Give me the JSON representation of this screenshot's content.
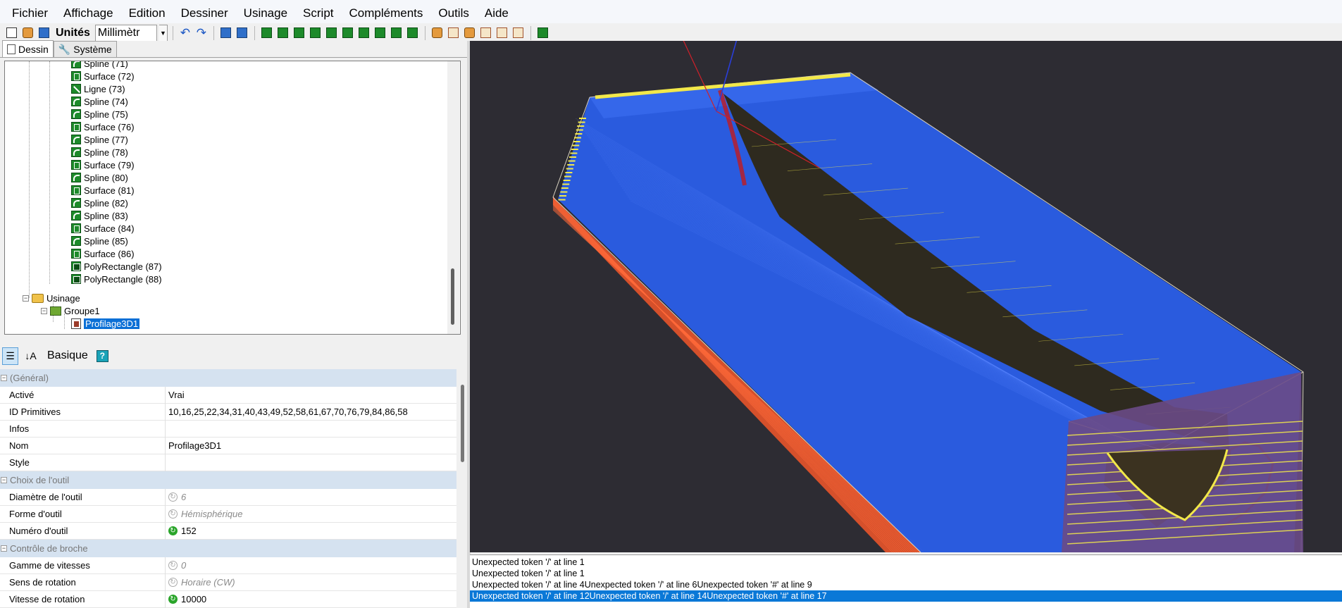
{
  "menu": [
    "Fichier",
    "Affichage",
    "Edition",
    "Dessiner",
    "Usinage",
    "Script",
    "Compléments",
    "Outils",
    "Aide"
  ],
  "toolbar": {
    "units_label": "Unités",
    "units_value": "Millimètr"
  },
  "tabs": [
    {
      "label": "Dessin",
      "icon": "page-icon"
    },
    {
      "label": "Système",
      "icon": "wrench-icon"
    }
  ],
  "tree": {
    "primitives": [
      {
        "label": "Spline (71)",
        "type": "spline"
      },
      {
        "label": "Surface (72)",
        "type": "surface"
      },
      {
        "label": "Ligne (73)",
        "type": "line"
      },
      {
        "label": "Spline (74)",
        "type": "spline"
      },
      {
        "label": "Spline (75)",
        "type": "spline"
      },
      {
        "label": "Surface (76)",
        "type": "surface"
      },
      {
        "label": "Spline (77)",
        "type": "spline"
      },
      {
        "label": "Spline (78)",
        "type": "spline"
      },
      {
        "label": "Surface (79)",
        "type": "surface"
      },
      {
        "label": "Spline (80)",
        "type": "spline"
      },
      {
        "label": "Surface (81)",
        "type": "surface"
      },
      {
        "label": "Spline (82)",
        "type": "spline"
      },
      {
        "label": "Spline (83)",
        "type": "spline"
      },
      {
        "label": "Surface (84)",
        "type": "surface"
      },
      {
        "label": "Spline (85)",
        "type": "spline"
      },
      {
        "label": "Surface (86)",
        "type": "surface"
      },
      {
        "label": "PolyRectangle (87)",
        "type": "polyrect"
      },
      {
        "label": "PolyRectangle (88)",
        "type": "polyrect"
      }
    ],
    "usinage": "Usinage",
    "groupe": "Groupe1",
    "operation": "Profilage3D1"
  },
  "prop_toolbar": {
    "basic_label": "Basique"
  },
  "props": [
    {
      "category": "(Général)",
      "rows": [
        {
          "name": "Activé",
          "value": "Vrai"
        },
        {
          "name": "ID Primitives",
          "value": "10,16,25,22,34,31,40,43,49,52,58,61,67,70,76,79,84,86,58"
        },
        {
          "name": "Infos",
          "value": ""
        },
        {
          "name": "Nom",
          "value": "Profilage3D1"
        },
        {
          "name": "Style",
          "value": ""
        }
      ]
    },
    {
      "category": "Choix de l'outil",
      "rows": [
        {
          "name": "Diamètre de l'outil",
          "value": "6",
          "state": "inherited"
        },
        {
          "name": "Forme d'outil",
          "value": "Hémisphérique",
          "state": "inherited"
        },
        {
          "name": "Numéro d'outil",
          "value": "152",
          "state": "set"
        }
      ]
    },
    {
      "category": "Contrôle de broche",
      "rows": [
        {
          "name": "Gamme de vitesses",
          "value": "0",
          "state": "inherited"
        },
        {
          "name": "Sens de rotation",
          "value": "Horaire (CW)",
          "state": "inherited"
        },
        {
          "name": "Vitesse de rotation",
          "value": "10000",
          "state": "set"
        }
      ]
    }
  ],
  "log": [
    "Unexpected token '/' at line 1",
    "Unexpected token '/' at line 1",
    "Unexpected token '/' at line 4Unexpected token '/' at line 6Unexpected token '#' at line 9",
    "Unexpected token '/' at line 12Unexpected token '/' at line 14Unexpected token '#' at line 17"
  ],
  "colors": {
    "viewport_bg": "#2d2c33",
    "toolpath_blue": "#2a5ee8",
    "stock_orange": "#e8542a",
    "surface_dark": "#2e2a1f",
    "highlight_yellow": "#f2e84a",
    "selection": "#0a6fd6"
  }
}
